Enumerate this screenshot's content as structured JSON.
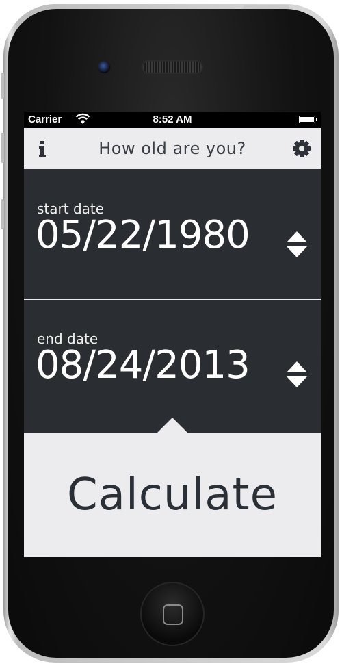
{
  "status_bar": {
    "carrier": "Carrier",
    "time": "8:52 AM"
  },
  "navbar": {
    "title": "How old are you?",
    "left_icon": "info-icon",
    "right_icon": "gear-icon"
  },
  "start": {
    "label": "start date",
    "value": "05/22/1980"
  },
  "end": {
    "label": "end date",
    "value": "08/24/2013"
  },
  "action": {
    "label": "Calculate"
  },
  "colors": {
    "screen_bg": "#2a2d31",
    "light_panel": "#ececee",
    "text_dark": "#2b3036",
    "text_light": "#ffffff"
  }
}
